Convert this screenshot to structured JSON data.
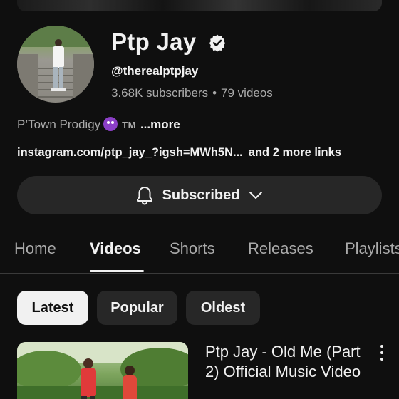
{
  "channel": {
    "name": "Ptp Jay",
    "handle": "@therealptpjay",
    "subscribers": "3.68K subscribers",
    "separator": "•",
    "video_count": "79 videos",
    "description": "P’Town Prodigy",
    "trademark": "TM",
    "more_label": "...more",
    "link_text": "instagram.com/ptp_jay_?igsh=MWh5N...",
    "more_links": "and 2 more links"
  },
  "subscribe_button": {
    "label": "Subscribed"
  },
  "tabs": [
    {
      "label": "Home"
    },
    {
      "label": "Videos"
    },
    {
      "label": "Shorts"
    },
    {
      "label": "Releases"
    },
    {
      "label": "Playlists"
    }
  ],
  "filters": [
    {
      "label": "Latest"
    },
    {
      "label": "Popular"
    },
    {
      "label": "Oldest"
    }
  ],
  "video": {
    "title": "Ptp Jay - Old Me (Part 2) Official Music Video"
  },
  "colors": {
    "background": "#0f0f0f",
    "surface": "#272727",
    "text": "#f1f1f1",
    "muted": "#aaaaaa"
  },
  "icons": [
    "verified-badge-icon",
    "bell-icon",
    "chevron-down-icon",
    "more-vert-icon"
  ]
}
